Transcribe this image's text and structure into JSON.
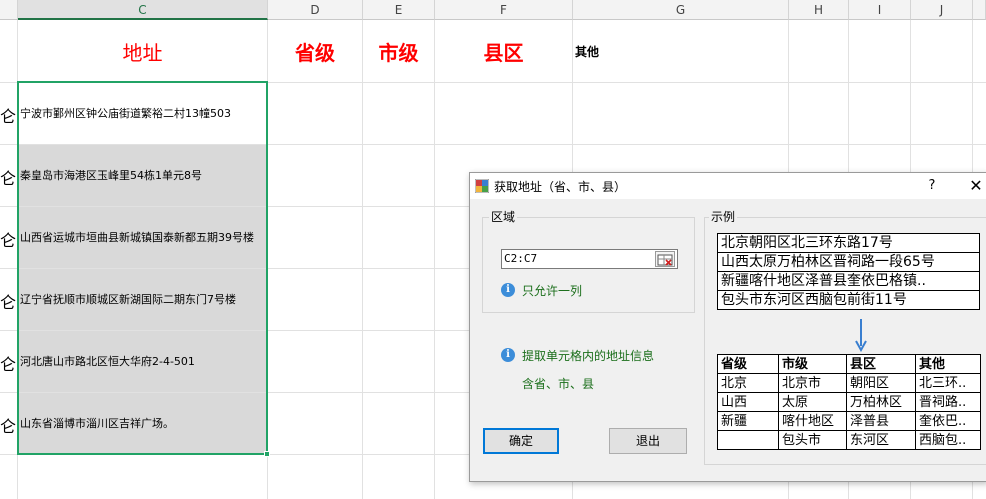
{
  "sheet": {
    "columns": [
      "C",
      "D",
      "E",
      "F",
      "G",
      "H",
      "I",
      "J"
    ],
    "header": {
      "address": "地址",
      "province": "省级",
      "city": "市级",
      "county": "县区",
      "other": "其他"
    },
    "row_prefix": "仑",
    "addresses": [
      "宁波市鄞州区钟公庙街道繁裕二村13幢503",
      "秦皇岛市海港区玉峰里54栋1单元8号",
      "山西省运城市垣曲县新城镇国泰新都五期39号楼",
      "辽宁省抚顺市顺城区新湖国际二期东门7号楼",
      "河北唐山市路北区恒大华府2-4-501",
      "山东省淄博市淄川区吉祥广场。"
    ],
    "selection_color": "#21a366",
    "header_color": "#ff0000"
  },
  "dialog": {
    "title": "获取地址（省、市、县）",
    "help": "?",
    "close": "✕",
    "region_group": "区域",
    "range_value": "C2:C7",
    "single_column_note": "只允许一列",
    "extract_note_line1": "提取单元格内的地址信息",
    "extract_note_line2": "含省、市、县",
    "ok": "确定",
    "exit": "退出",
    "example_group": "示例",
    "example_input": [
      "北京朝阳区北三环东路17号",
      "山西太原万柏林区晋祠路一段65号",
      "新疆喀什地区泽普县奎依巴格镇..",
      "包头市东河区西脑包前街11号"
    ],
    "example_headers": [
      "省级",
      "市级",
      "县区",
      "其他"
    ],
    "example_rows": [
      [
        "北京",
        "北京市",
        "朝阳区",
        "北三环.."
      ],
      [
        "山西",
        "太原",
        "万柏林区",
        "晋祠路.."
      ],
      [
        "新疆",
        "喀什地区",
        "泽普县",
        "奎依巴.."
      ],
      [
        "",
        "包头市",
        "东河区",
        "西脑包.."
      ]
    ],
    "arrow_color": "#3a7fd0"
  }
}
